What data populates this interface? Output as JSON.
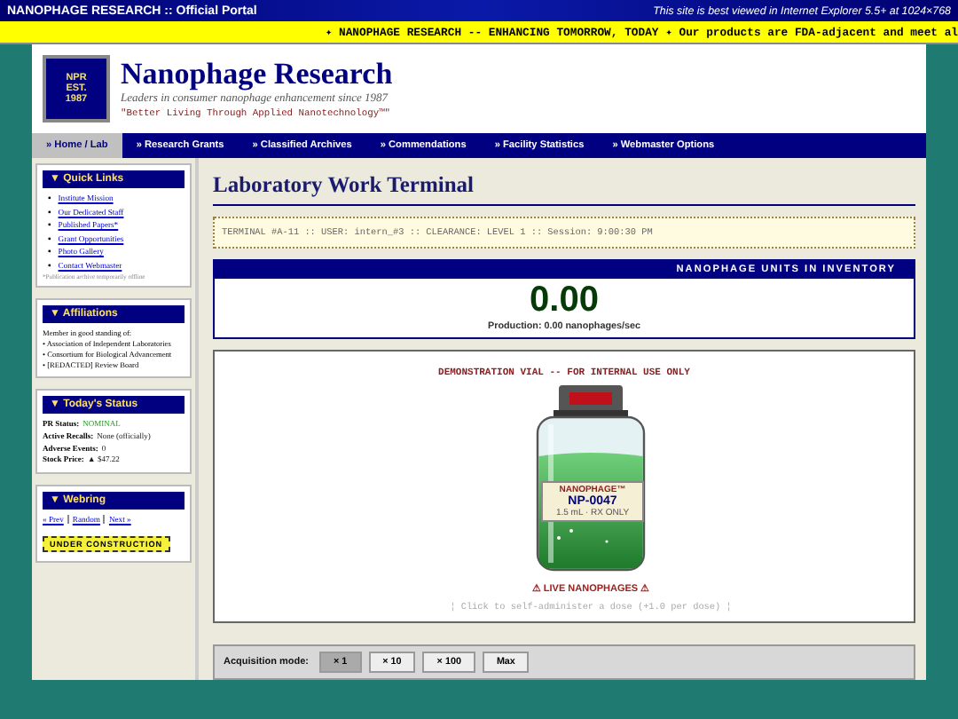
{
  "top_bar": {
    "title": "NANOPHAGE RESEARCH :: Official Portal",
    "notice": "This site is best viewed in Internet Explorer 5.5+ at 1024×768"
  },
  "marquee": "✦ NANOPHAGE RESEARCH -- ENHANCING TOMORROW, TODAY ✦ Our products are FDA-adjacent and meet al",
  "header": {
    "logo": [
      "NPR",
      "EST.",
      "1987"
    ],
    "title": "Nanophage Research",
    "tagline": "Leaders in consumer nanophage enhancement since 1987",
    "motto": "\"Better Living Through Applied Nanotechnology™\""
  },
  "nav": [
    {
      "label": "» Home / Lab",
      "selected": true
    },
    {
      "label": "» Research Grants",
      "selected": false
    },
    {
      "label": "» Classified Archives",
      "selected": false
    },
    {
      "label": "» Commendations",
      "selected": false
    },
    {
      "label": "» Facility Statistics",
      "selected": false
    },
    {
      "label": "» Webmaster Options",
      "selected": false
    }
  ],
  "sidebar": {
    "quick_links": {
      "title": "▼ Quick Links",
      "marker": "▪",
      "links": [
        "Institute Mission",
        "Our Dedicated Staff",
        "Published Papers*",
        "Grant Opportunities",
        "Photo Gallery",
        "Contact Webmaster"
      ],
      "note": "*Publication archive temporarily offline"
    },
    "affiliations": {
      "title": "▼ Affiliations",
      "intro": "Member in good standing of:",
      "items": [
        "• Association of Independent Laboratories",
        "• Consortium for Biological Advancement",
        "• [REDACTED] Review Board"
      ]
    },
    "status": {
      "title": "▼ Today's Status",
      "rows": [
        {
          "label": "PR Status:",
          "value": "NOMINAL",
          "kind": "good"
        },
        {
          "label": "Active Recalls:",
          "value": "None (officially)",
          "kind": "plain"
        },
        {
          "label": "Adverse Events:",
          "value": "0",
          "kind": "plain"
        },
        {
          "label": "Stock Price:",
          "value": "▲ $47.22",
          "kind": "plain"
        }
      ]
    },
    "webring": {
      "title": "▼ Webring",
      "links": [
        "« Prev",
        "Random",
        "Next »"
      ],
      "badge": "UNDER CONSTRUCTION"
    }
  },
  "main": {
    "title": "Laboratory Work Terminal",
    "terminal": "TERMINAL #A-11 :: USER: intern_#3 :: CLEARANCE: LEVEL 1 :: Session: 9:00:30 PM",
    "inventory": {
      "heading": "NANOPHAGE UNITS IN INVENTORY",
      "count": "0.00",
      "production": "Production: 0.00 nanophages/sec"
    },
    "vial": {
      "caption": "DEMONSTRATION VIAL -- FOR INTERNAL USE ONLY",
      "label_brand": "NANOPHAGE™",
      "label_code": "NP-0047",
      "label_note": "1.5 mL · RX ONLY",
      "warning": "⚠ LIVE NANOPHAGES ⚠",
      "hint": "¦ Click to self-administer a dose (+1.0 per dose) ¦"
    },
    "acquisition": {
      "label": "Acquisition mode:",
      "modes": [
        {
          "label": "× 1",
          "selected": true
        },
        {
          "label": "× 10",
          "selected": false
        },
        {
          "label": "× 100",
          "selected": false
        },
        {
          "label": "Max",
          "selected": false
        }
      ]
    }
  }
}
